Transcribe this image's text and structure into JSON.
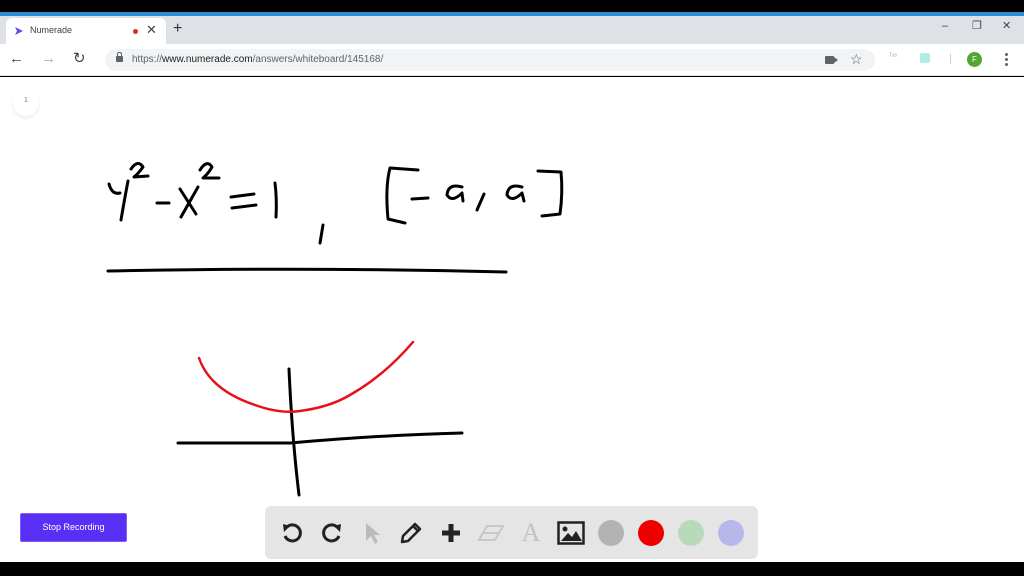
{
  "browser": {
    "tab": {
      "title": "Numerade",
      "recording_indicator": "red-dot",
      "close": "✕"
    },
    "new_tab": "+",
    "window_controls": {
      "minimize": "–",
      "maximize": "❐",
      "close": "✕"
    },
    "nav": {
      "back": "←",
      "forward": "→",
      "reload": "↻"
    },
    "url": {
      "scheme": "https://",
      "host": "www.numerade.com",
      "path": "/answers/whiteboard/145168/"
    },
    "extension_label": "ᵀᵃˢ",
    "profile_initial": "F"
  },
  "whiteboard": {
    "page_number": "1",
    "handwriting": {
      "equation": "y^2 - x^2 = 1",
      "interval": "[-a, a]",
      "stroke_colors": {
        "ink": "#000000",
        "curve": "#e8101a"
      }
    },
    "stop_recording_label": "Stop Recording",
    "toolbar": {
      "tools": [
        {
          "name": "undo",
          "icon": "undo-icon",
          "enabled": true
        },
        {
          "name": "redo",
          "icon": "redo-icon",
          "enabled": true
        },
        {
          "name": "select",
          "icon": "pointer-icon",
          "enabled": false
        },
        {
          "name": "pen",
          "icon": "pencil-icon",
          "enabled": true
        },
        {
          "name": "add",
          "icon": "plus-icon",
          "enabled": true
        },
        {
          "name": "eraser",
          "icon": "eraser-icon",
          "enabled": false
        },
        {
          "name": "text",
          "icon": "text-icon",
          "enabled": false,
          "glyph": "A"
        },
        {
          "name": "image",
          "icon": "image-icon",
          "enabled": true
        }
      ],
      "colors": [
        "#b3b3b3",
        "#ee0000",
        "#b7dbb9",
        "#b9b6ec"
      ],
      "selected_color": "#ee0000"
    }
  }
}
